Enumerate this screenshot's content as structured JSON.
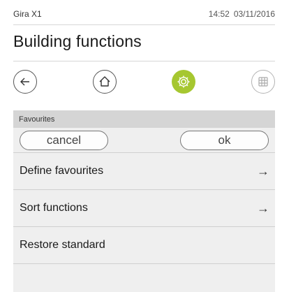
{
  "statusbar": {
    "device": "Gira X1",
    "time": "14:52",
    "date": "03/11/2016"
  },
  "header": {
    "title": "Building functions"
  },
  "nav": {
    "back": "back-arrow-icon",
    "home": "home-icon",
    "settings": "settings-gear-icon",
    "grid": "grid-icon",
    "accent_color": "#a6c730"
  },
  "panel": {
    "header": "Favourites",
    "cancel_label": "cancel",
    "ok_label": "ok",
    "items": [
      {
        "label": "Define favourites",
        "arrow": "→"
      },
      {
        "label": "Sort functions",
        "arrow": "→"
      },
      {
        "label": "Restore standard",
        "arrow": ""
      }
    ]
  }
}
